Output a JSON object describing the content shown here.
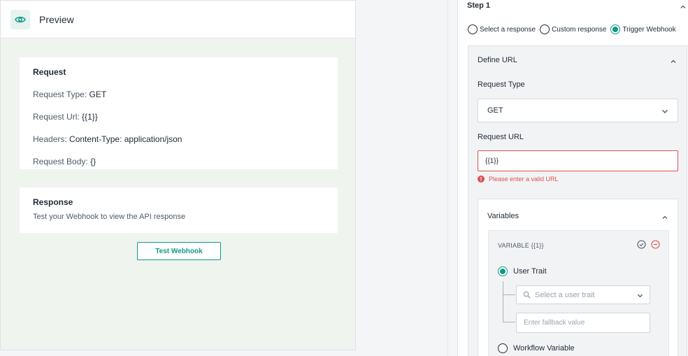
{
  "preview": {
    "title": "Preview",
    "request": {
      "title": "Request",
      "type_label": "Request Type:",
      "type_value": "GET",
      "url_label": "Request Url:",
      "url_value": "{{1}}",
      "headers_label": "Headers:",
      "headers_value": "Content-Type: application/json",
      "body_label": "Request Body:",
      "body_value": "{}"
    },
    "response": {
      "title": "Response",
      "text": "Test your Webhook to view the API response"
    },
    "test_button": "Test Webhook"
  },
  "config": {
    "step_title": "Step 1",
    "response_options": [
      {
        "label": "Select a response",
        "selected": false
      },
      {
        "label": "Custom response",
        "selected": false
      },
      {
        "label": "Trigger Webhook",
        "selected": true
      }
    ],
    "define_url": {
      "title": "Define URL",
      "request_type_label": "Request Type",
      "request_type_value": "GET",
      "request_url_label": "Request URL",
      "request_url_value": "{{1}}",
      "error": "Please enter a valid URL"
    },
    "variables": {
      "title": "Variables",
      "variable_name": "VARIABLE {{1}}",
      "option_user_trait": "User Trait",
      "trait_placeholder": "Select a user trait",
      "fallback_placeholder": "Enter fallback value",
      "option_workflow": "Workflow Variable"
    }
  },
  "colors": {
    "accent": "#0f9a86",
    "error": "#d9534f",
    "preview_bg": "#eff4ef"
  }
}
